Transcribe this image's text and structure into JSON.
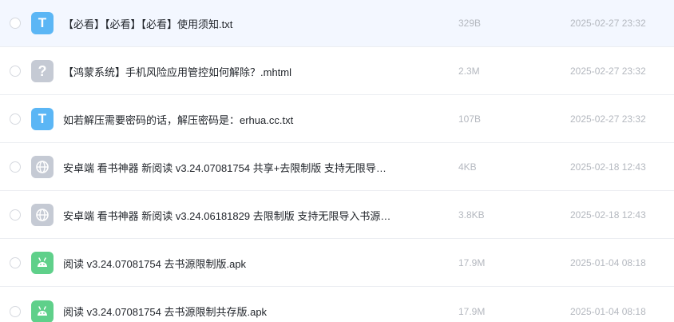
{
  "files": [
    {
      "name": "【必看】【必看】【必看】使用须知.txt",
      "size": "329B",
      "date": "2025-02-27 23:32",
      "icon": "txt-file-icon",
      "glyph": "T",
      "active": true
    },
    {
      "name": "【鸿蒙系统】手机风险应用管控如何解除？.mhtml",
      "size": "2.3M",
      "date": "2025-02-27 23:32",
      "icon": "unknown-file-icon",
      "glyph": "?"
    },
    {
      "name": "如若解压需要密码的话，解压密码是：erhua.cc.txt",
      "size": "107B",
      "date": "2025-02-27 23:32",
      "icon": "txt-file-icon",
      "glyph": "T"
    },
    {
      "name": "安卓端 看书神器 新阅读 v3.24.07081754 共享+去限制版 支持无限导…",
      "size": "4KB",
      "date": "2025-02-18 12:43",
      "icon": "web-link-icon",
      "glyph": ""
    },
    {
      "name": "安卓端 看书神器 新阅读 v3.24.06181829 去限制版 支持无限导入书源…",
      "size": "3.8KB",
      "date": "2025-02-18 12:43",
      "icon": "web-link-icon",
      "glyph": ""
    },
    {
      "name": "阅读 v3.24.07081754 去书源限制版.apk",
      "size": "17.9M",
      "date": "2025-01-04 08:18",
      "icon": "android-apk-icon",
      "glyph": ""
    },
    {
      "name": "阅读 v3.24.07081754 去书源限制共存版.apk",
      "size": "17.9M",
      "date": "2025-01-04 08:18",
      "icon": "android-apk-icon",
      "glyph": ""
    }
  ]
}
